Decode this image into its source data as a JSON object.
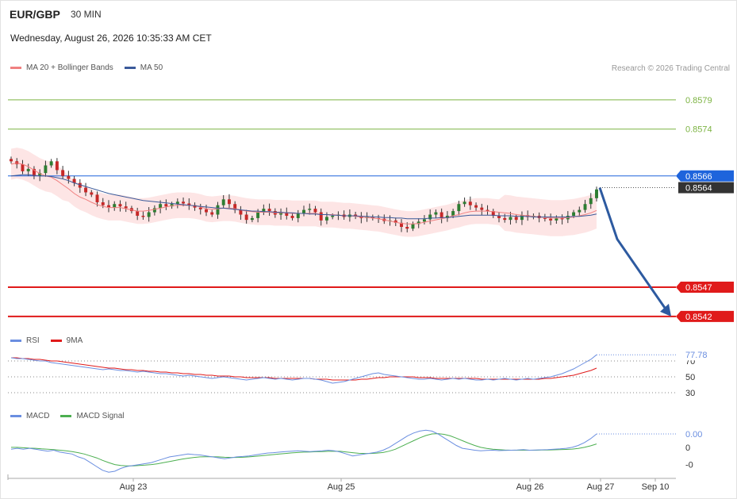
{
  "header": {
    "symbol": "EUR/GBP",
    "timeframe": "30 MIN",
    "datetime": "Wednesday, August 26, 2026 10:35:33 AM CET",
    "copyright": "Research © 2026 Trading Central"
  },
  "colors": {
    "ma20": "#f08080",
    "band_fill": "#fde0e0",
    "ma50": "#3a5a9a",
    "up_candle": "#2e7d32",
    "down_candle": "#c62828",
    "resistance": "#7cb342",
    "current_level": "#1e64dc",
    "support": "#e01a1a",
    "forecast_arrow": "#2d5aa0",
    "rsi": "#6a8ee0",
    "rsi_9ma": "#e01a1a",
    "macd": "#6a8ee0",
    "macd_signal": "#4caf50"
  },
  "chart_data": [
    {
      "type": "candlestick",
      "panel": "price",
      "legend": [
        {
          "name": "MA 20 + Bollinger Bands",
          "color": "#f08080"
        },
        {
          "name": "MA 50",
          "color": "#3a5a9a"
        }
      ],
      "x_ticks": [
        "Aug 23",
        "Aug 25",
        "Aug 26",
        "Aug 27",
        "Sep 10"
      ],
      "levels": [
        {
          "value": 0.8579,
          "label": "0.8579",
          "kind": "resistance"
        },
        {
          "value": 0.8574,
          "label": "0.8574",
          "kind": "resistance"
        },
        {
          "value": 0.8566,
          "label": "0.8566",
          "kind": "current"
        },
        {
          "value": 0.8564,
          "label": "0.8564",
          "kind": "last"
        },
        {
          "value": 0.8547,
          "label": "0.8547",
          "kind": "support"
        },
        {
          "value": 0.8542,
          "label": "0.8542",
          "kind": "support"
        }
      ],
      "ylim": [
        0.85405,
        0.85825
      ],
      "closes": [
        0.85685,
        0.8568,
        0.85668,
        0.85672,
        0.8566,
        0.85665,
        0.85678,
        0.85685,
        0.8567,
        0.8566,
        0.85655,
        0.85648,
        0.8564,
        0.85632,
        0.85628,
        0.85615,
        0.8561,
        0.85606,
        0.85612,
        0.85608,
        0.85605,
        0.856,
        0.85592,
        0.8559,
        0.85598,
        0.85605,
        0.85612,
        0.85608,
        0.85612,
        0.85616,
        0.85613,
        0.8561,
        0.85606,
        0.85603,
        0.85598,
        0.85594,
        0.8561,
        0.8562,
        0.85612,
        0.85602,
        0.85594,
        0.85585,
        0.85588,
        0.85598,
        0.85604,
        0.856,
        0.85594,
        0.85598,
        0.85592,
        0.85588,
        0.85596,
        0.85602,
        0.85604,
        0.85598,
        0.85584,
        0.8559,
        0.85592,
        0.85594,
        0.8559,
        0.85594,
        0.85592,
        0.85588,
        0.8559,
        0.85588,
        0.85587,
        0.85583,
        0.85584,
        0.8558,
        0.85573,
        0.8557,
        0.85578,
        0.85582,
        0.85586,
        0.85594,
        0.85598,
        0.85588,
        0.85592,
        0.856,
        0.85612,
        0.85616,
        0.8561,
        0.85606,
        0.85602,
        0.856,
        0.85592,
        0.85588,
        0.85585,
        0.8559,
        0.85585,
        0.85593,
        0.8559,
        0.85592,
        0.85588,
        0.85587,
        0.85584,
        0.85588,
        0.85586,
        0.85592,
        0.85598,
        0.85602,
        0.85612,
        0.85622,
        0.85637
      ],
      "ma20": [
        0.8568,
        0.85682,
        0.8568,
        0.85676,
        0.8567,
        0.85664,
        0.8566,
        0.85658,
        0.85652,
        0.85645,
        0.85638,
        0.8563,
        0.85624,
        0.8562,
        0.85615,
        0.85611,
        0.85608,
        0.85606,
        0.85606,
        0.85606,
        0.85604,
        0.85602,
        0.856,
        0.856,
        0.85601,
        0.85603,
        0.85605,
        0.85607,
        0.85609,
        0.8561,
        0.8561,
        0.8561,
        0.85609,
        0.85607,
        0.85604,
        0.85603,
        0.85604,
        0.85605,
        0.85605,
        0.85604,
        0.85602,
        0.856,
        0.85599,
        0.85598,
        0.85598,
        0.85598,
        0.85597,
        0.85597,
        0.85597,
        0.85596,
        0.85596,
        0.85596,
        0.85596,
        0.85596,
        0.85594,
        0.85594,
        0.85594,
        0.85593,
        0.85592,
        0.85592,
        0.85591,
        0.8559,
        0.85589,
        0.85588,
        0.85587,
        0.85585,
        0.85583,
        0.85581,
        0.85579,
        0.85578,
        0.85578,
        0.85579,
        0.85581,
        0.85583,
        0.85585,
        0.85587,
        0.85589,
        0.85592,
        0.85594,
        0.85597,
        0.85599,
        0.856,
        0.856,
        0.856,
        0.85599,
        0.85598,
        0.85597,
        0.85596,
        0.85594,
        0.85593,
        0.85592,
        0.85591,
        0.8559,
        0.85589,
        0.85588,
        0.85588,
        0.85588,
        0.85589,
        0.8559,
        0.85592,
        0.85594,
        0.85597,
        0.85601
      ],
      "ma50": [
        0.8566,
        0.85661,
        0.85662,
        0.85662,
        0.85661,
        0.8566,
        0.8566,
        0.85659,
        0.85657,
        0.85655,
        0.85652,
        0.85648,
        0.85645,
        0.85642,
        0.85639,
        0.85636,
        0.85633,
        0.8563,
        0.85628,
        0.85626,
        0.85624,
        0.85622,
        0.8562,
        0.85618,
        0.85617,
        0.85616,
        0.85615,
        0.85614,
        0.85613,
        0.85612,
        0.85611,
        0.8561,
        0.85609,
        0.85608,
        0.85607,
        0.85606,
        0.85605,
        0.85605,
        0.85604,
        0.85603,
        0.85602,
        0.85601,
        0.856,
        0.856,
        0.85599,
        0.85599,
        0.85598,
        0.85598,
        0.85597,
        0.85597,
        0.85596,
        0.85596,
        0.85595,
        0.85595,
        0.85594,
        0.85594,
        0.85593,
        0.85593,
        0.85592,
        0.85592,
        0.85592,
        0.85591,
        0.85591,
        0.8559,
        0.8559,
        0.85589,
        0.85589,
        0.85588,
        0.85588,
        0.85587,
        0.85587,
        0.85587,
        0.85587,
        0.85588,
        0.85588,
        0.85589,
        0.85589,
        0.8559,
        0.85591,
        0.85592,
        0.85593,
        0.85593,
        0.85593,
        0.85593,
        0.85593,
        0.85592,
        0.85592,
        0.85592,
        0.85591,
        0.85591,
        0.85591,
        0.8559,
        0.8559,
        0.8559,
        0.8559,
        0.8559,
        0.8559,
        0.8559,
        0.85591,
        0.85591,
        0.85592,
        0.85593,
        0.85595
      ],
      "forecast": {
        "from": 0.8564,
        "to": 0.8542
      }
    },
    {
      "type": "line",
      "panel": "rsi",
      "legend": [
        {
          "name": "RSI",
          "color": "#6a8ee0"
        },
        {
          "name": "9MA",
          "color": "#e01a1a"
        }
      ],
      "y_ticks": [
        "70",
        "50",
        "30"
      ],
      "ylim": [
        20,
        85
      ],
      "last_value": "77.78",
      "rsi": [
        74,
        73,
        73,
        72,
        71,
        70,
        70,
        68,
        67,
        66,
        65,
        64,
        63,
        62,
        61,
        60,
        59,
        60,
        59,
        58,
        58,
        57,
        56,
        57,
        56,
        55,
        54,
        54,
        53,
        52,
        51,
        52,
        51,
        50,
        49,
        48,
        49,
        50,
        49,
        48,
        47,
        46,
        47,
        48,
        49,
        48,
        47,
        48,
        47,
        46,
        47,
        48,
        48,
        47,
        46,
        44,
        42,
        43,
        44,
        46,
        48,
        50,
        52,
        54,
        55,
        53,
        52,
        51,
        50,
        49,
        48,
        47,
        47,
        48,
        47,
        46,
        47,
        48,
        47,
        48,
        47,
        46,
        46,
        47,
        46,
        47,
        48,
        47,
        46,
        47,
        48,
        47,
        48,
        49,
        50,
        52,
        54,
        57,
        60,
        64,
        68,
        72,
        77.78
      ],
      "ma9": [
        74,
        74,
        73,
        73,
        72,
        72,
        71,
        70,
        70,
        69,
        68,
        67,
        66,
        65,
        64,
        63,
        62,
        61,
        61,
        60,
        59,
        59,
        58,
        58,
        57,
        57,
        56,
        56,
        55,
        55,
        54,
        54,
        53,
        53,
        52,
        52,
        51,
        51,
        51,
        50,
        50,
        49,
        49,
        49,
        49,
        49,
        48,
        48,
        48,
        48,
        48,
        48,
        48,
        47,
        47,
        47,
        46,
        46,
        46,
        46,
        46,
        47,
        47,
        48,
        49,
        49,
        50,
        50,
        50,
        50,
        50,
        49,
        49,
        49,
        48,
        48,
        48,
        48,
        48,
        48,
        48,
        48,
        47,
        47,
        47,
        47,
        47,
        47,
        47,
        47,
        47,
        47,
        47,
        48,
        48,
        49,
        50,
        51,
        52,
        54,
        56,
        58,
        61
      ]
    },
    {
      "type": "line",
      "panel": "macd",
      "legend": [
        {
          "name": "MACD",
          "color": "#6a8ee0"
        },
        {
          "name": "MACD Signal",
          "color": "#4caf50"
        }
      ],
      "y_ticks": [
        "0",
        "-0"
      ],
      "last_value": "0.00",
      "ylim": [
        -1.5,
        1.2
      ],
      "macd": [
        -0.1,
        -0.05,
        -0.1,
        -0.05,
        -0.1,
        -0.15,
        -0.2,
        -0.15,
        -0.25,
        -0.3,
        -0.35,
        -0.5,
        -0.6,
        -0.8,
        -1.0,
        -1.2,
        -1.3,
        -1.25,
        -1.1,
        -1.0,
        -0.95,
        -0.9,
        -0.85,
        -0.8,
        -0.7,
        -0.6,
        -0.5,
        -0.45,
        -0.4,
        -0.35,
        -0.38,
        -0.4,
        -0.45,
        -0.5,
        -0.55,
        -0.6,
        -0.55,
        -0.5,
        -0.48,
        -0.45,
        -0.4,
        -0.35,
        -0.3,
        -0.28,
        -0.25,
        -0.22,
        -0.2,
        -0.18,
        -0.2,
        -0.22,
        -0.2,
        -0.18,
        -0.15,
        -0.18,
        -0.25,
        -0.35,
        -0.45,
        -0.4,
        -0.35,
        -0.3,
        -0.25,
        -0.15,
        0.0,
        0.2,
        0.4,
        0.6,
        0.75,
        0.85,
        0.9,
        0.85,
        0.7,
        0.5,
        0.3,
        0.1,
        -0.05,
        -0.1,
        -0.15,
        -0.18,
        -0.16,
        -0.15,
        -0.17,
        -0.16,
        -0.15,
        -0.14,
        -0.12,
        -0.15,
        -0.14,
        -0.13,
        -0.12,
        -0.1,
        -0.08,
        -0.05,
        0.0,
        0.1,
        0.25,
        0.45,
        0.7
      ],
      "signal": [
        0.0,
        0.0,
        -0.02,
        -0.04,
        -0.05,
        -0.08,
        -0.1,
        -0.12,
        -0.15,
        -0.18,
        -0.22,
        -0.28,
        -0.35,
        -0.45,
        -0.55,
        -0.68,
        -0.8,
        -0.9,
        -0.95,
        -0.97,
        -0.97,
        -0.95,
        -0.93,
        -0.9,
        -0.86,
        -0.8,
        -0.74,
        -0.68,
        -0.62,
        -0.57,
        -0.53,
        -0.5,
        -0.49,
        -0.49,
        -0.5,
        -0.52,
        -0.53,
        -0.53,
        -0.52,
        -0.5,
        -0.47,
        -0.44,
        -0.41,
        -0.38,
        -0.35,
        -0.32,
        -0.29,
        -0.27,
        -0.25,
        -0.24,
        -0.23,
        -0.22,
        -0.21,
        -0.2,
        -0.21,
        -0.24,
        -0.28,
        -0.31,
        -0.32,
        -0.32,
        -0.3,
        -0.27,
        -0.2,
        -0.1,
        0.05,
        0.2,
        0.35,
        0.5,
        0.62,
        0.7,
        0.72,
        0.68,
        0.6,
        0.48,
        0.35,
        0.22,
        0.1,
        0.0,
        -0.06,
        -0.1,
        -0.12,
        -0.14,
        -0.15,
        -0.15,
        -0.15,
        -0.15,
        -0.15,
        -0.14,
        -0.14,
        -0.13,
        -0.12,
        -0.11,
        -0.09,
        -0.06,
        0.0,
        0.08,
        0.18
      ]
    }
  ]
}
